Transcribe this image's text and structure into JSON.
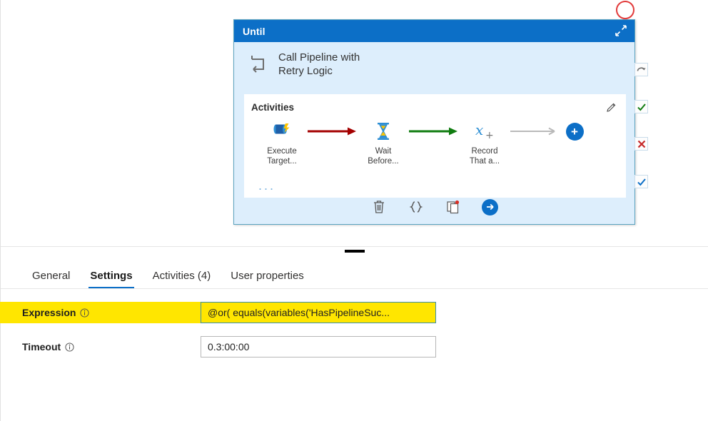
{
  "canvas": {
    "annotation": {
      "name": "red-circle-highlight",
      "color": "#e23b3b"
    }
  },
  "until_card": {
    "header_title": "Until",
    "collapse_icon": "collapse-diagonal-icon",
    "activity_name": "Call Pipeline with\nRetry Logic",
    "activity_icon": "until-loop-icon",
    "activities_section": {
      "label": "Activities",
      "edit_icon": "pencil-icon",
      "ellipsis": "...",
      "nodes": [
        {
          "icon": "execute-pipeline-icon",
          "label": "Execute\nTarget..."
        },
        {
          "icon": "wait-hourglass-icon",
          "label": "Wait\nBefore..."
        },
        {
          "icon": "set-variable-icon",
          "label": "Record\nThat a..."
        }
      ],
      "connectors": [
        {
          "name": "arrow-failure",
          "color": "#a40000"
        },
        {
          "name": "arrow-success",
          "color": "#107c10"
        },
        {
          "name": "arrow-completion",
          "color": "#b9b9b9"
        }
      ],
      "add_button": "+"
    },
    "toolbar": [
      {
        "name": "delete-icon",
        "glyph": "trash"
      },
      {
        "name": "code-view-icon",
        "glyph": "{}"
      },
      {
        "name": "clone-icon",
        "glyph": "copy"
      },
      {
        "name": "run-icon",
        "glyph": "arrow-right"
      }
    ]
  },
  "connector_handles": [
    {
      "name": "connector-retry",
      "type": "retry",
      "color": "#6d6d6d"
    },
    {
      "name": "connector-success",
      "type": "success",
      "color": "#107c10"
    },
    {
      "name": "connector-failure",
      "type": "failure",
      "color": "#c62828"
    },
    {
      "name": "connector-completion",
      "type": "completion",
      "color": "#0c6fc7"
    }
  ],
  "properties": {
    "tabs": [
      {
        "label": "General",
        "active": false
      },
      {
        "label": "Settings",
        "active": true
      },
      {
        "label": "Activities (4)",
        "active": false
      },
      {
        "label": "User properties",
        "active": false
      }
    ],
    "fields": [
      {
        "label": "Expression",
        "value": "@or( equals(variables('HasPipelineSuc...",
        "highlighted": true,
        "info_icon": "info-icon"
      },
      {
        "label": "Timeout",
        "value": "0.3:00:00",
        "highlighted": false,
        "info_icon": "info-icon"
      }
    ]
  },
  "colors": {
    "header_blue": "#0c6fc7",
    "card_body": "#ddeefc",
    "card_border": "#5ba3bf",
    "highlight_yellow": "#ffe600",
    "accent": "#0c6fc7"
  }
}
